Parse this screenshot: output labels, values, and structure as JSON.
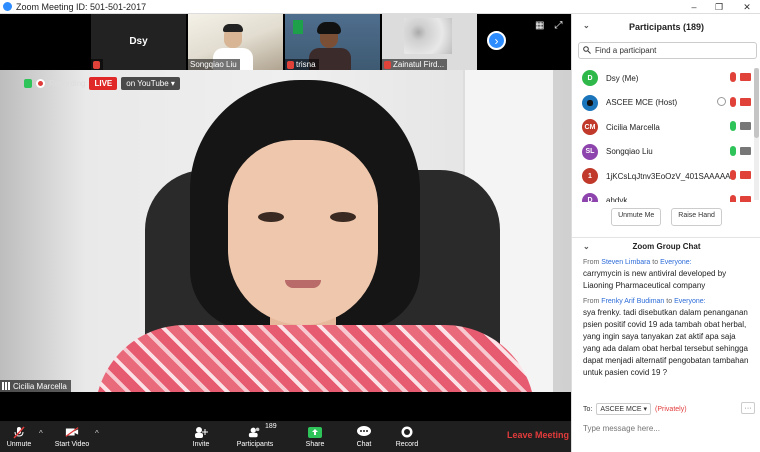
{
  "window": {
    "title": "Zoom Meeting ID: 501-501-2017",
    "controls": [
      "–",
      "❐",
      "✕"
    ]
  },
  "thumbnails": [
    {
      "name": "Dsy",
      "big_label": "Dsy"
    },
    {
      "name": "Songqiao Liu"
    },
    {
      "name": "trisna"
    },
    {
      "name": "Zainatul Fird..."
    }
  ],
  "recording": {
    "status": "Recording",
    "live_label": "LIVE",
    "destination": "on YouTube"
  },
  "main_video": {
    "speaker_name": "Cicilia Marcella"
  },
  "toolbar": {
    "unmute": "Unmute",
    "start_video": "Start Video",
    "invite": "Invite",
    "participants": "Participants",
    "participant_count": "189",
    "share": "Share",
    "chat": "Chat",
    "record": "Record",
    "leave": "Leave Meeting"
  },
  "participants_panel": {
    "title": "Participants (189)",
    "search_placeholder": "Find a participant",
    "items": [
      {
        "initials": "D",
        "name": "Dsy (Me)",
        "color": "#2fb84a",
        "mic": "muted",
        "video": "off"
      },
      {
        "initials": "",
        "name": "ASCEE MCE (Host)",
        "color": "#1b75bb",
        "mic": "muted",
        "video": "off"
      },
      {
        "initials": "CM",
        "name": "Cicilia Marcella",
        "color": "#c0392b",
        "mic": "on",
        "video": "on"
      },
      {
        "initials": "SL",
        "name": "Songqiao Liu",
        "color": "#8e44ad",
        "mic": "on",
        "video": "on"
      },
      {
        "initials": "1",
        "name": "1jKCsLqJtnv3EoOzV_401SAAAAAI",
        "color": "#c0392b",
        "mic": "muted",
        "video": "off"
      },
      {
        "initials": "D",
        "name": "ahdyk",
        "color": "#8e44ad",
        "mic": "muted",
        "video": "off"
      }
    ],
    "unmute_me": "Unmute Me",
    "raise_hand": "Raise Hand"
  },
  "chat": {
    "title": "Zoom Group Chat",
    "from_label": "From",
    "to_label": "to",
    "messages": [
      {
        "from": "Steven Limbara",
        "to": "Everyone:",
        "text": "carrymycin is new antiviral developed by Liaoning Pharmaceutical company"
      },
      {
        "from": "Frenky Arif Budiman",
        "to": "Everyone:",
        "text": "sya frenky. tadi disebutkan dalam penanganan psien positif covid 19 ada tambah obat herbal, yang ingin saya tanyakan zat aktif apa saja yang ada dalam obat herbal tersebut sehingga dapat menjadi alternatif pengobatan tambahan untuk pasien covid 19 ?"
      }
    ],
    "recipient_label": "To:",
    "recipient": "ASCEE MCE",
    "privacy": "(Privately)",
    "more": "···",
    "input_placeholder": "Type message here..."
  }
}
